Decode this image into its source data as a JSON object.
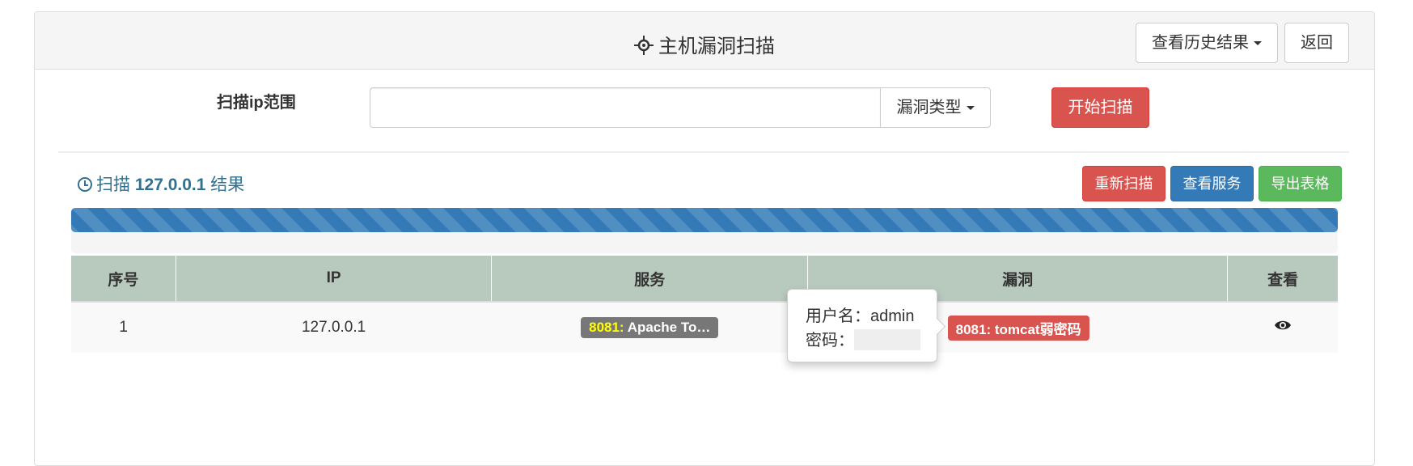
{
  "header": {
    "title": "主机漏洞扫描",
    "history_button": "查看历史结果",
    "back_button": "返回"
  },
  "scan_form": {
    "range_label": "扫描ip范围",
    "range_value": "",
    "vuln_type_button": "漏洞类型",
    "start_button": "开始扫描"
  },
  "result": {
    "prefix": "扫描",
    "target": "127.0.0.1",
    "suffix": "结果",
    "rescan_button": "重新扫描",
    "view_services_button": "查看服务",
    "export_button": "导出表格",
    "progress_percent": 100
  },
  "table": {
    "headers": [
      "序号",
      "IP",
      "服务",
      "漏洞",
      "查看"
    ],
    "rows": [
      {
        "index": "1",
        "ip": "127.0.0.1",
        "service_port": "8081:",
        "service_name": "Apache To…",
        "vuln": "8081: tomcat弱密码"
      }
    ]
  },
  "popover": {
    "username_label": "用户名：",
    "username": "admin",
    "password_label": "密码："
  },
  "colors": {
    "danger": "#d9534f",
    "primary": "#337ab7",
    "success": "#5cb85c",
    "table_header": "#b8c9bd"
  }
}
